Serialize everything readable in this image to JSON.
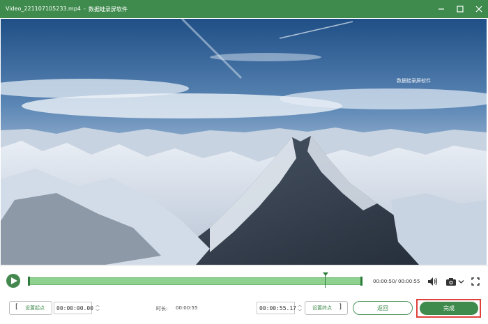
{
  "window": {
    "file_name": "Video_221107105233.mp4",
    "separator": "-",
    "app_name": "数据蛙录屏软件",
    "controls": {
      "minimize": "minimize-icon",
      "maximize": "maximize-icon",
      "close": "close-icon"
    }
  },
  "video": {
    "watermark": "数据蛙录屏软件"
  },
  "player": {
    "play_icon": "play-icon",
    "time_readout": "00:00:50/ 00:00:55",
    "playhead_fraction": 0.91,
    "volume_icon": "volume-icon",
    "snapshot_icon": "camera-icon",
    "fullscreen_icon": "fullscreen-icon"
  },
  "trim": {
    "set_start_label": "设置起点",
    "start_value": "00:00:00.00",
    "duration_label": "时长:",
    "duration_value": "00:00:55",
    "end_value": "00:00:55.17",
    "set_end_label": "设置终点"
  },
  "actions": {
    "back_label": "返回",
    "done_label": "完成"
  },
  "colors": {
    "brand_green": "#3f8b4d",
    "timeline_fill": "#8fd18f",
    "highlight_red": "#e0403a"
  }
}
